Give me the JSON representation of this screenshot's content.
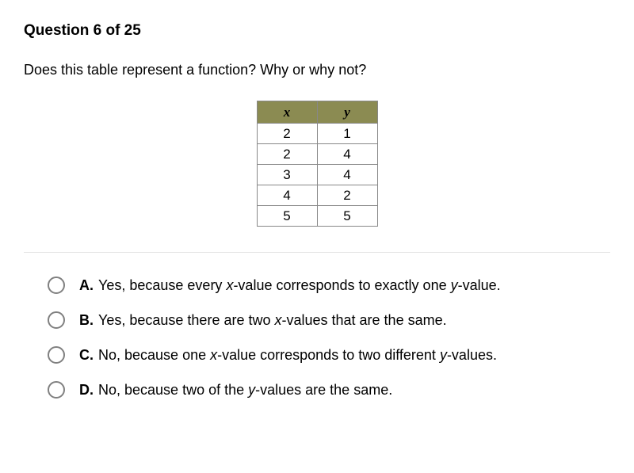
{
  "header": "Question 6 of 25",
  "prompt": "Does this table represent a function? Why or why not?",
  "table": {
    "headers": {
      "col1": "x",
      "col2": "y"
    },
    "rows": [
      {
        "x": "2",
        "y": "1"
      },
      {
        "x": "2",
        "y": "4"
      },
      {
        "x": "3",
        "y": "4"
      },
      {
        "x": "4",
        "y": "2"
      },
      {
        "x": "5",
        "y": "5"
      }
    ]
  },
  "options": [
    {
      "label": "A.",
      "pre": "Yes, because every ",
      "v1": "x",
      "mid": "-value corresponds to exactly one ",
      "v2": "y",
      "post": "-value."
    },
    {
      "label": "B.",
      "pre": "Yes, because there are two ",
      "v1": "x",
      "mid": "-values that are the same.",
      "v2": "",
      "post": ""
    },
    {
      "label": "C.",
      "pre": "No, because one ",
      "v1": "x",
      "mid": "-value corresponds to two different ",
      "v2": "y",
      "post": "-values."
    },
    {
      "label": "D.",
      "pre": "No, because two of the ",
      "v1": "y",
      "mid": "-values are the same.",
      "v2": "",
      "post": ""
    }
  ]
}
